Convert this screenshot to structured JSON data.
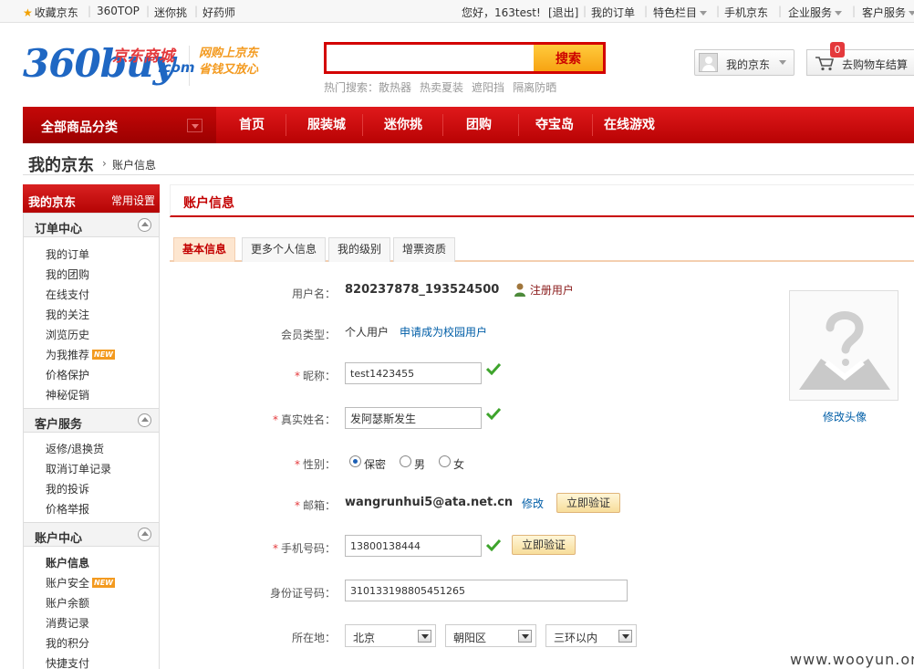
{
  "topbar": {
    "favorite": "收藏京东",
    "links_left": [
      "360TOP",
      "迷你挑",
      "好药师"
    ],
    "greeting": "您好，163test!",
    "logout": "[退出]",
    "my_order": "我的订单",
    "featured": "特色栏目",
    "mobile": "手机京东",
    "enterprise": "企业服务",
    "service": "客户服务"
  },
  "header": {
    "logo_main": "360buy",
    "logo_cn": "京东商城",
    "logo_com": ".com",
    "slogan": [
      "网购上京东",
      "省钱又放心"
    ],
    "search_placeholder": "",
    "search_button": "搜索",
    "hot_label": "热门搜索：",
    "hot_words": [
      "散热器",
      "热卖夏装",
      "遮阳挡",
      "隔离防晒"
    ],
    "my_jd": "我的京东",
    "cart": "去购物车结算",
    "cart_count": "0"
  },
  "nav": {
    "all": "全部商品分类",
    "items": [
      "首页",
      "服装城",
      "迷你挑",
      "团购",
      "夺宝岛",
      "在线游戏"
    ]
  },
  "breadcrumb": {
    "title": "我的京东",
    "current": "账户信息"
  },
  "sidebar": {
    "title": "我的京东",
    "settings": "常用设置",
    "new_badge": "NEW",
    "sections": [
      {
        "title": "订单中心",
        "items": [
          "我的订单",
          "我的团购",
          "在线支付",
          "我的关注",
          "浏览历史",
          "为我推荐",
          "价格保护",
          "神秘促销"
        ]
      },
      {
        "title": "客户服务",
        "items": [
          "返修/退换货",
          "取消订单记录",
          "我的投诉",
          "价格举报"
        ]
      },
      {
        "title": "账户中心",
        "items": [
          "账户信息",
          "账户安全",
          "账户余额",
          "消费记录",
          "我的积分",
          "快捷支付"
        ]
      }
    ]
  },
  "main": {
    "title": "账户信息",
    "tabs": [
      "基本信息",
      "更多个人信息",
      "我的级别",
      "增票资质"
    ],
    "form": {
      "username_label": "用户名：",
      "username": "820237878_193524500",
      "reg_user": "注册用户",
      "member_type_label": "会员类型：",
      "member_type": "个人用户",
      "campus_link": "申请成为校园用户",
      "nickname_label": "昵称：",
      "nickname": "test1423455",
      "realname_label": "真实姓名：",
      "realname": "发阿瑟斯发生",
      "gender_label": "性别：",
      "gender_options": [
        "保密",
        "男",
        "女"
      ],
      "email_label": "邮箱：",
      "email": "wangrunhui5@ata.net.cn",
      "modify": "修改",
      "verify": "立即验证",
      "phone_label": "手机号码：",
      "phone": "13800138444",
      "id_label": "身份证号码：",
      "id_number": "310133198805451265",
      "location_label": "所在地：",
      "province": "北京",
      "district": "朝阳区",
      "area": "三环以内",
      "required_mark": "*"
    },
    "avatar_change": "修改头像"
  },
  "watermark": "www.wooyun.org"
}
